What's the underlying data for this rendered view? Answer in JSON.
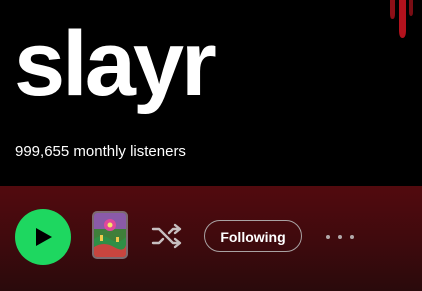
{
  "artist": {
    "name": "slayr",
    "monthly_listeners": "999,655 monthly listeners"
  },
  "actions": {
    "play_icon": "play-icon",
    "shuffle_icon": "shuffle-icon",
    "follow_label": "Following",
    "more_icon": "more-options-icon"
  },
  "colors": {
    "hero_background": "#000000",
    "action_bar_background": "#520a0e",
    "play_button": "#1ed760",
    "accent_drip": "#b3121d"
  }
}
